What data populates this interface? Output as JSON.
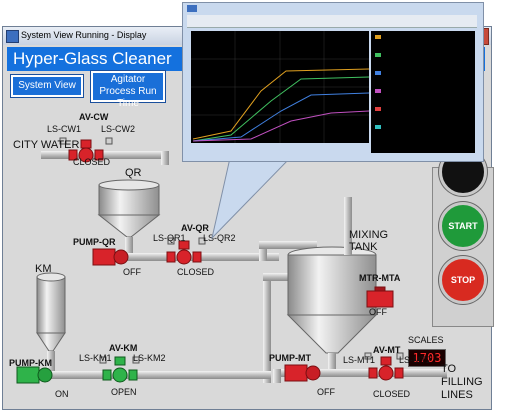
{
  "window": {
    "title": "System View Running - Display",
    "close": "✕",
    "banner": "Hyper-Glass Cleaner"
  },
  "nav": {
    "system_view": "System View",
    "agitator": "Agitator Process Run Time"
  },
  "labels": {
    "city_water": "CITY WATER",
    "qr": "QR",
    "km": "KM",
    "mixing_tank": "MIXING TANK",
    "to_filling": "TO FILLING LINES",
    "scales": "SCALES"
  },
  "valves": {
    "av_cw": {
      "name": "AV-CW",
      "ls1": "LS-CW1",
      "ls2": "LS-CW2",
      "state": "CLOSED"
    },
    "av_qr": {
      "name": "AV-QR",
      "ls1": "LS-QR1",
      "ls2": "LS-QR2",
      "state": "CLOSED"
    },
    "av_km": {
      "name": "AV-KM",
      "ls1": "LS-KM1",
      "ls2": "LS-KM2",
      "state": "OPEN"
    },
    "av_mt": {
      "name": "AV-MT",
      "ls1": "LS-MT1",
      "ls2": "LS-MT2",
      "state": "CLOSED"
    }
  },
  "pumps": {
    "qr": {
      "name": "PUMP-QR",
      "state": "OFF"
    },
    "km": {
      "name": "PUMP-KM",
      "state": "ON"
    },
    "mt": {
      "name": "PUMP-MT",
      "state": "OFF"
    }
  },
  "motor": {
    "name": "MTR-MTA",
    "state": "OFF"
  },
  "scales_value": "1703",
  "buttons": {
    "start": "START",
    "stop": "STOP"
  },
  "colors": {
    "banner_blue": "#1471de",
    "valve_red": "#d8232a",
    "valve_green": "#2fb34a",
    "start_green": "#1f9a3a",
    "stop_red": "#d82a20"
  }
}
